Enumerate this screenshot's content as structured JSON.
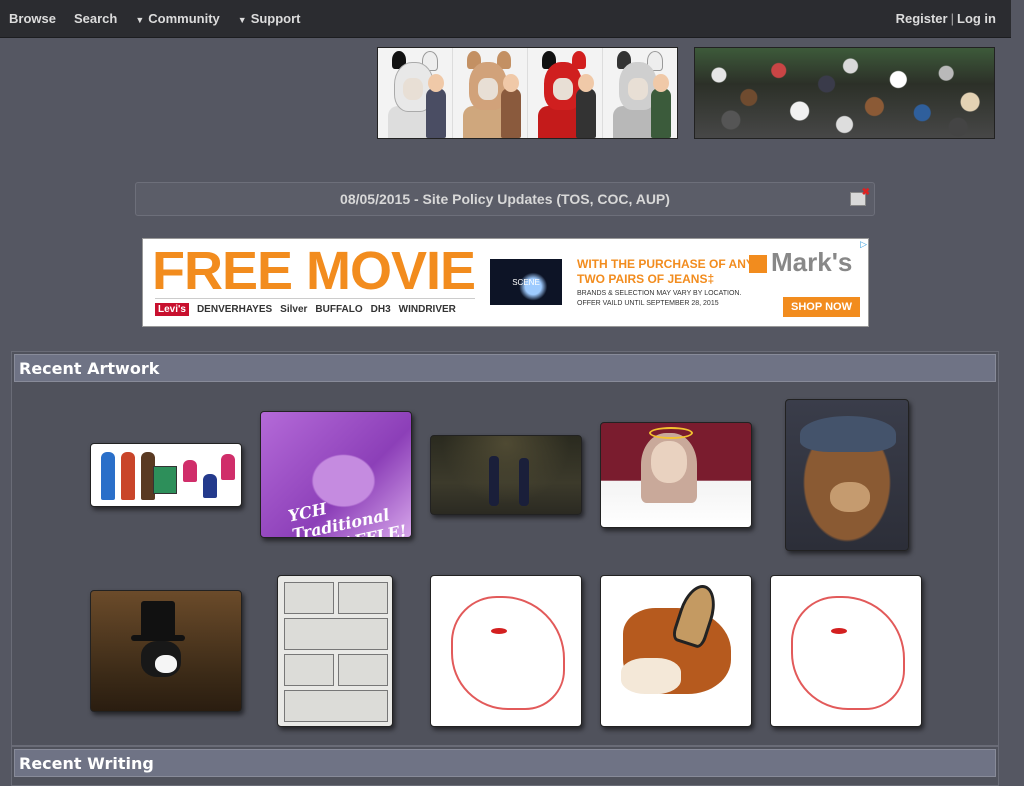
{
  "nav": {
    "browse": "Browse",
    "search": "Search",
    "community": "Community",
    "support": "Support",
    "register": "Register",
    "login": "Log in",
    "separator": "|"
  },
  "notice": {
    "text": "08/05/2015 - Site Policy Updates (TOS, COC, AUP)"
  },
  "ad": {
    "headline": "FREE MOVIE",
    "offer": "WITH THE PURCHASE OF ANY TWO PAIRS OF JEANS‡",
    "fine_print": "BRANDS & SELECTION MAY VARY BY LOCATION. OFFER VAILD UNTIL SEPTEMBER 28, 2015",
    "brand": "Mark's",
    "cta": "SHOP NOW",
    "scene_label": "SCENE",
    "brands": [
      "Levi's",
      "DENVERHAYES",
      "Silver",
      "BUFFALO",
      "DH3",
      "WINDRIVER"
    ]
  },
  "sections": {
    "recent_artwork": "Recent Artwork",
    "recent_writing": "Recent Writing"
  },
  "artwork_thumbs": [
    {
      "id": "t1",
      "subject": "character sheet"
    },
    {
      "id": "t2",
      "subject": "YCH raffle",
      "text": "YCH Traditional Art RAFFLE!"
    },
    {
      "id": "t3",
      "subject": "game scene"
    },
    {
      "id": "t4",
      "subject": "angel character"
    },
    {
      "id": "t5",
      "subject": "bear in hat"
    },
    {
      "id": "t6",
      "subject": "fursuit with top hat"
    },
    {
      "id": "t7",
      "subject": "comic page"
    },
    {
      "id": "t8",
      "subject": "ych sketch"
    },
    {
      "id": "t9",
      "subject": "fox portrait"
    },
    {
      "id": "t10",
      "subject": "ych sketch"
    }
  ]
}
